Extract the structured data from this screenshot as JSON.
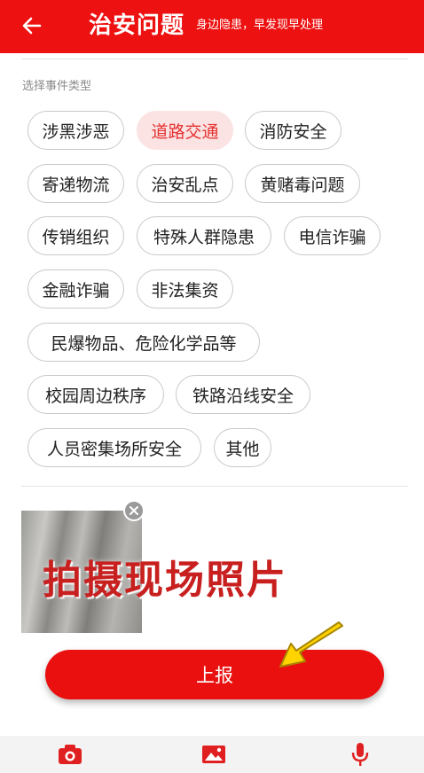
{
  "header": {
    "title": "治安问题",
    "subtitle": "身边隐患，早发现早处理",
    "background": "#ee1111"
  },
  "section": {
    "label": "选择事件类型"
  },
  "tags": [
    {
      "label": "涉黑涉恶",
      "selected": false
    },
    {
      "label": "道路交通",
      "selected": true
    },
    {
      "label": "消防安全",
      "selected": false
    },
    {
      "label": "寄递物流",
      "selected": false
    },
    {
      "label": "治安乱点",
      "selected": false
    },
    {
      "label": "黄赌毒问题",
      "selected": false
    },
    {
      "label": "传销组织",
      "selected": false
    },
    {
      "label": "特殊人群隐患",
      "selected": false
    },
    {
      "label": "电信诈骗",
      "selected": false
    },
    {
      "label": "金融诈骗",
      "selected": false
    },
    {
      "label": "非法集资",
      "selected": false
    },
    {
      "label": "民爆物品、危险化学品等",
      "selected": false
    },
    {
      "label": "校园周边秩序",
      "selected": false
    },
    {
      "label": "铁路沿线安全",
      "selected": false
    },
    {
      "label": "人员密集场所安全",
      "selected": false
    },
    {
      "label": "其他",
      "selected": false
    }
  ],
  "photo": {
    "annotation": "拍摄现场照片"
  },
  "submit": {
    "label": "上报"
  },
  "toolbar": {
    "icons": [
      "camera-icon",
      "image-icon",
      "microphone-icon"
    ],
    "icon_color": "#e02020"
  },
  "colors": {
    "accent": "#ee1111",
    "selected_tag_bg": "#fbe3e3",
    "selected_tag_text": "#e53030"
  }
}
